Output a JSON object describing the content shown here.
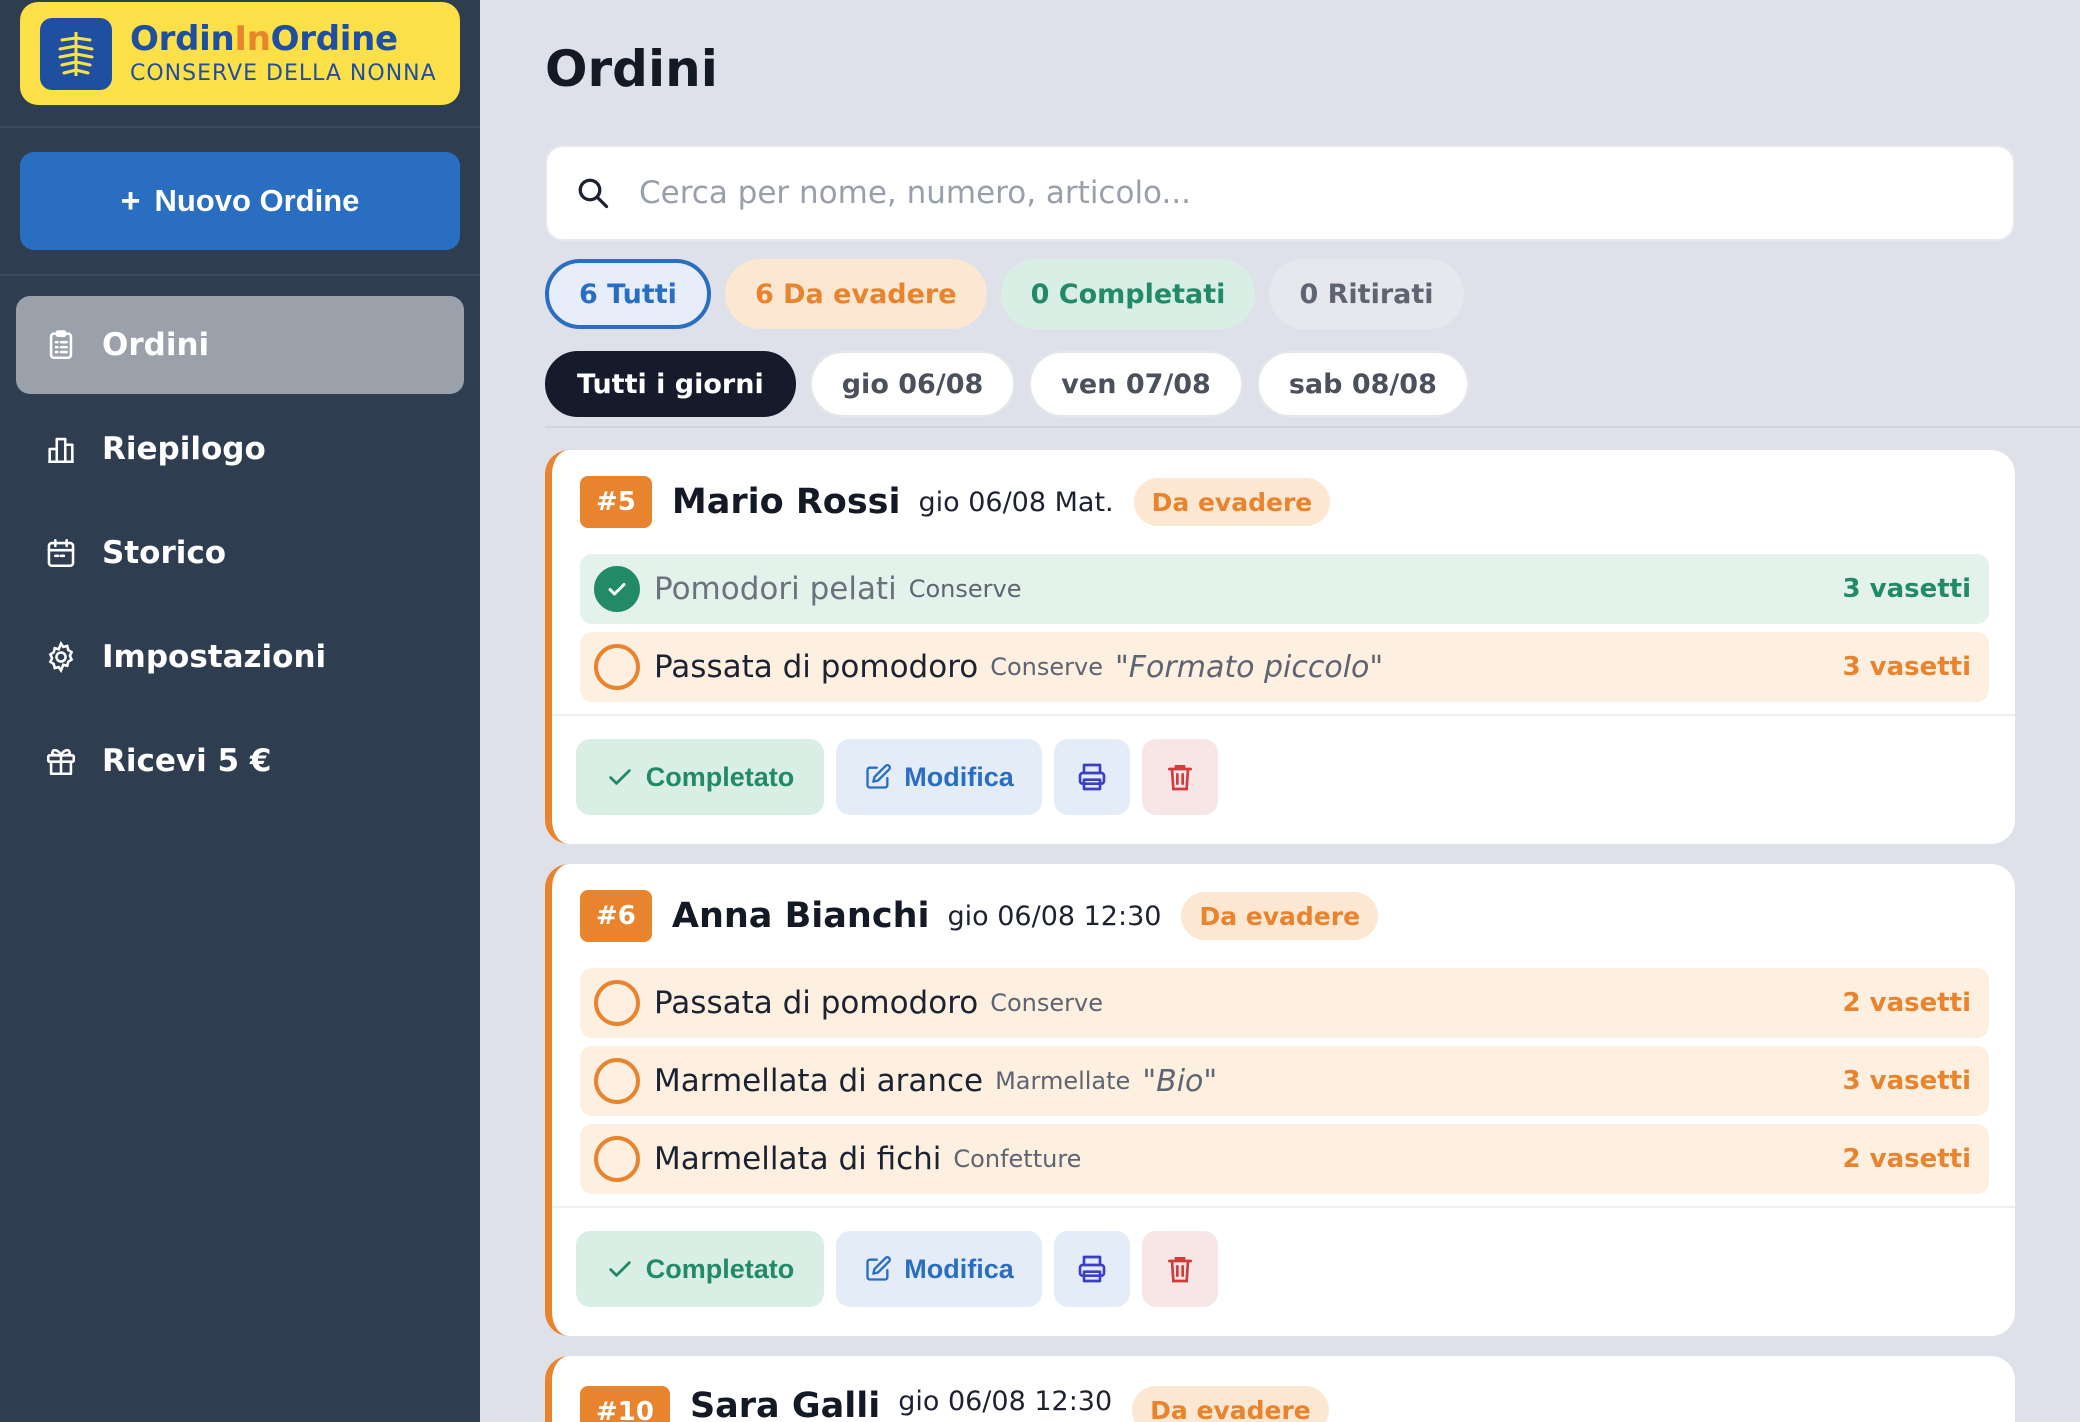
{
  "brand": {
    "title_a": "Ordin",
    "title_b": "In",
    "title_c": "Ordine",
    "subtitle": "CONSERVE DELLA NONNA"
  },
  "sidebar": {
    "new_order_label": "Nuovo Ordine",
    "items": [
      {
        "label": "Ordini",
        "icon": "clipboard-icon",
        "active": true
      },
      {
        "label": "Riepilogo",
        "icon": "bar-chart-icon"
      },
      {
        "label": "Storico",
        "icon": "calendar-icon"
      },
      {
        "label": "Impostazioni",
        "icon": "gear-icon"
      },
      {
        "label": "Ricevi 5 €",
        "icon": "gift-icon"
      }
    ]
  },
  "main": {
    "title": "Ordini",
    "search_placeholder": "Cerca per nome, numero, articolo...",
    "filters": [
      {
        "label": "6 Tutti",
        "selected": true
      },
      {
        "label": "6 Da evadere"
      },
      {
        "label": "0 Completati"
      },
      {
        "label": "0 Ritirati"
      }
    ],
    "days": [
      {
        "label": "Tutti i giorni",
        "selected": true
      },
      {
        "label": "gio 06/08"
      },
      {
        "label": "ven 07/08"
      },
      {
        "label": "sab 08/08"
      }
    ]
  },
  "orders": [
    {
      "number": "#5",
      "customer": "Mario Rossi",
      "when": "gio 06/08 Mat.",
      "status": "Da evadere",
      "items": [
        {
          "name": "Pomodori pelati",
          "category": "Conserve",
          "note": "",
          "qty": "3 vasetti",
          "done": true
        },
        {
          "name": "Passata di pomodoro",
          "category": "Conserve",
          "note": "\"Formato piccolo\"",
          "qty": "3 vasetti",
          "done": false
        }
      ],
      "complete_label": "Completato",
      "edit_label": "Modifica"
    },
    {
      "number": "#6",
      "customer": "Anna Bianchi",
      "when": "gio 06/08 12:30",
      "status": "Da evadere",
      "items": [
        {
          "name": "Passata di pomodoro",
          "category": "Conserve",
          "note": "",
          "qty": "2 vasetti",
          "done": false
        },
        {
          "name": "Marmellata di arance",
          "category": "Marmellate",
          "note": "\"Bio\"",
          "qty": "3 vasetti",
          "done": false
        },
        {
          "name": "Marmellata di fichi",
          "category": "Confetture",
          "note": "",
          "qty": "2 vasetti",
          "done": false
        }
      ],
      "complete_label": "Completato",
      "edit_label": "Modifica"
    },
    {
      "number": "#10",
      "customer": "Sara Galli",
      "when": "gio 06/08 12:30",
      "status": "Da evadere"
    }
  ],
  "colors": {
    "sidebar": "#2e3d4f",
    "brand_bg": "#fde047",
    "primary": "#2a6ec2",
    "pending": "#e8832e",
    "done": "#228a66"
  }
}
